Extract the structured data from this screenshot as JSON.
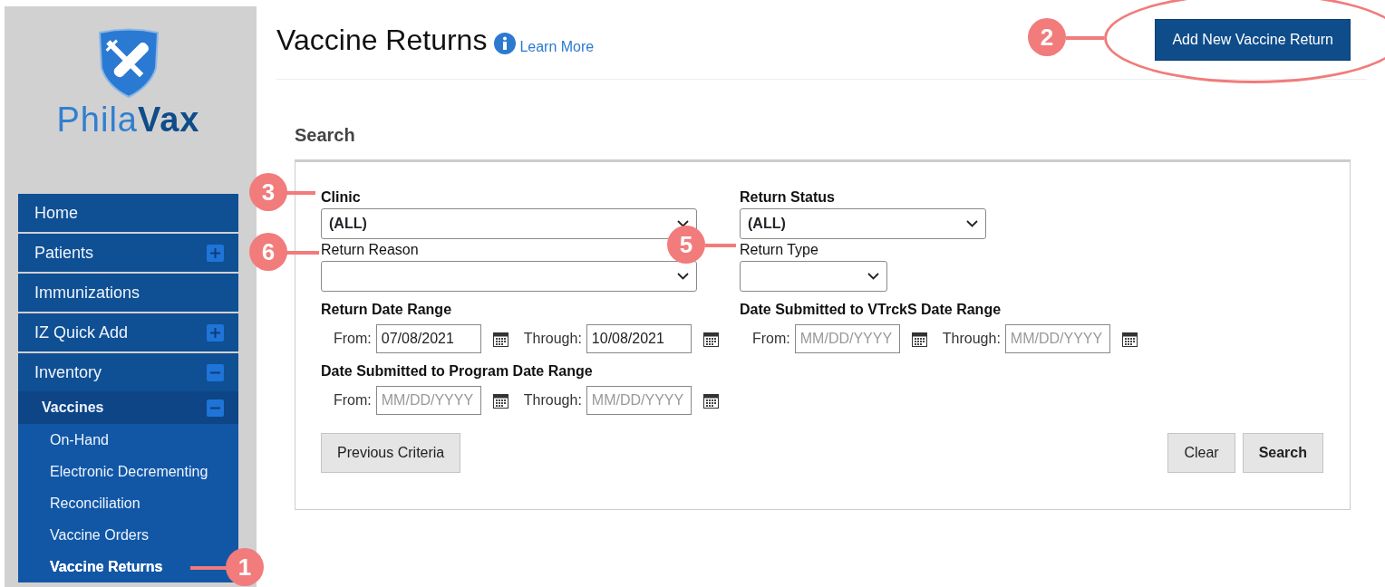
{
  "logo": {
    "text": "Phila**Vax**"
  },
  "sidebar": {
    "items": [
      {
        "label": "Home",
        "selected": false
      },
      {
        "label": "Patients",
        "expanded": false,
        "selected": false
      },
      {
        "label": "Immunizations",
        "selected": false
      },
      {
        "label": "IZ Quick Add",
        "expanded": false,
        "selected": false
      },
      {
        "label": "Inventory",
        "expanded": true,
        "selected": false,
        "children": [
          {
            "label": "Vaccines",
            "expanded": true,
            "selected": false,
            "children": [
              {
                "label": "On-Hand",
                "selected": false
              },
              {
                "label": "Electronic Decrementing",
                "selected": false
              },
              {
                "label": "Reconciliation",
                "selected": false
              },
              {
                "label": "Vaccine Orders",
                "selected": false
              },
              {
                "label": "Vaccine Returns",
                "selected": true
              }
            ]
          }
        ]
      }
    ]
  },
  "header": {
    "title": "Vaccine Returns",
    "learn_more": "Learn More",
    "add_button": "Add New Vaccine Return"
  },
  "search": {
    "heading": "Search",
    "selects": [
      {
        "label": "Clinic",
        "value": "(ALL)",
        "kind": "wide"
      },
      {
        "label": "Return Status",
        "value": "(ALL)",
        "kind": "medium"
      },
      {
        "label": "Return Reason",
        "kind": "wide"
      },
      {
        "label": "Return Type",
        "kind": "narrow"
      }
    ],
    "date_ranges": [
      {
        "label": "Return Date Range",
        "from": {
          "label": "From:",
          "value": "07/08/2021"
        },
        "through": {
          "label": "Through:",
          "value": "10/08/2021"
        }
      },
      {
        "label": "Date Submitted to VTrckS Date Range",
        "from": {
          "label": "From:",
          "placeholder": "MM/DD/YYYY"
        },
        "through": {
          "label": "Through:",
          "placeholder": "MM/DD/YYYY"
        }
      },
      {
        "label": "Date Submitted to Program Date Range",
        "from": {
          "label": "From:",
          "placeholder": "MM/DD/YYYY"
        },
        "through": {
          "label": "Through:",
          "placeholder": "MM/DD/YYYY"
        }
      }
    ],
    "buttons": {
      "previous": "Previous Criteria",
      "clear": "Clear",
      "search": "Search"
    }
  },
  "callouts": [
    {
      "number": "1"
    },
    {
      "number": "2"
    },
    {
      "number": "3"
    },
    {
      "number": "5"
    },
    {
      "number": "6"
    }
  ]
}
